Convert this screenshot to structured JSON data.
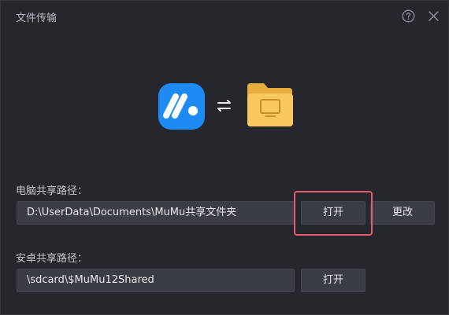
{
  "window": {
    "title": "文件传输",
    "help_icon": "help-circle-icon",
    "close_icon": "close-icon"
  },
  "illustration": {
    "app_logo": "mumu-logo-icon",
    "transfer_icon": "swap-arrows-icon",
    "folder_icon": "shared-folder-icon"
  },
  "pc_share": {
    "label": "电脑共享路径：",
    "path": "D:\\UserData\\Documents\\MuMu共享文件夹",
    "open_label": "打开",
    "change_label": "更改"
  },
  "android_share": {
    "label": "安卓共享路径：",
    "path": "\\sdcard\\$MuMu12Shared",
    "open_label": "打开"
  },
  "colors": {
    "background": "#25272c",
    "field_bg": "#3a3d43",
    "highlight": "#e85a6b",
    "logo_blue": "#1e8bf5",
    "folder_yellow": "#f6c85f"
  }
}
